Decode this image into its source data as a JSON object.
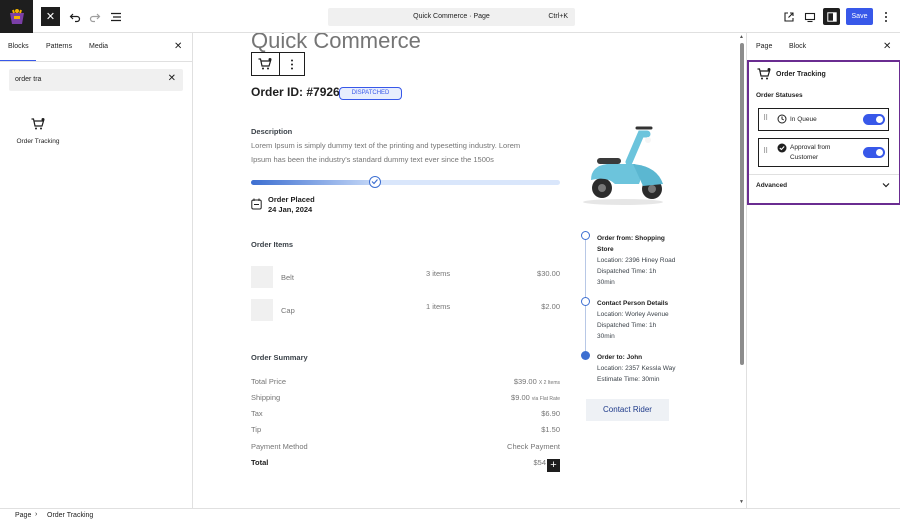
{
  "toolbar": {
    "command_title": "Quick Commerce · Page",
    "command_shortcut": "Ctrl+K",
    "save_label": "Save",
    "close_label": "✕"
  },
  "left_panel": {
    "tabs": [
      "Blocks",
      "Patterns",
      "Media"
    ],
    "search_value": "order tra",
    "result_label": "Order Tracking"
  },
  "canvas": {
    "site_title": "Quick Commerce",
    "order_id": "Order ID: #7926",
    "status_badge": "DISPATCHED",
    "description_heading": "Description",
    "description_line1": "Lorem Ipsum is simply dummy text of the printing and typesetting industry. Lorem",
    "description_line2": "Ipsum has been the industry's standard dummy text ever since the 1500s",
    "progress": 0.4,
    "placed_label": "Order Placed",
    "placed_date": "24 Jan, 2024",
    "items_heading": "Order Items",
    "items": [
      {
        "name": "Belt",
        "qty": "3 items",
        "price": "$30.00"
      },
      {
        "name": "Cap",
        "qty": "1 items",
        "price": "$2.00"
      }
    ],
    "summary_heading": "Order Summary",
    "summary": [
      {
        "label": "Total Price",
        "value": "$39.00",
        "note": "X 2 Items"
      },
      {
        "label": "Shipping",
        "value": "$9.00",
        "note": "via Flat Rate"
      },
      {
        "label": "Tax",
        "value": "$6.90",
        "note": ""
      },
      {
        "label": "Tip",
        "value": "$1.50",
        "note": ""
      },
      {
        "label": "Payment Method",
        "value": "Check Payment",
        "note": ""
      }
    ],
    "total_label": "Total",
    "total_value": "$54",
    "timeline": [
      {
        "title_a": "Order from: Shopping",
        "title_b": "Store",
        "l1": "Location: 2396 Hiney Road",
        "l2": "Dispatched Time: 1h",
        "l3": "30min"
      },
      {
        "title_a": "Contact Person Details",
        "title_b": "",
        "l1": "Location: Worley Avenue",
        "l2": "Dispatched Time: 1h",
        "l3": "30min"
      },
      {
        "title_a": "Order to: John",
        "title_b": "",
        "l1": "Location: 2357 Kessla Way",
        "l2": "Estimate Time: 30min",
        "l3": ""
      }
    ],
    "contact_rider": "Contact Rider"
  },
  "right_panel": {
    "tabs": [
      "Page",
      "Block"
    ],
    "block_title": "Order Tracking",
    "statuses_heading": "Order Statuses",
    "status_1": "In Queue",
    "status_2_a": "Approval from",
    "status_2_b": "Customer",
    "advanced": "Advanced"
  },
  "breadcrumb": [
    "Page",
    "Order Tracking"
  ],
  "colors": {
    "accent": "#3858e9",
    "highlight": "#6a2c91",
    "progress_start": "#3d6fd1",
    "progress_end": "#d9e6fb"
  }
}
